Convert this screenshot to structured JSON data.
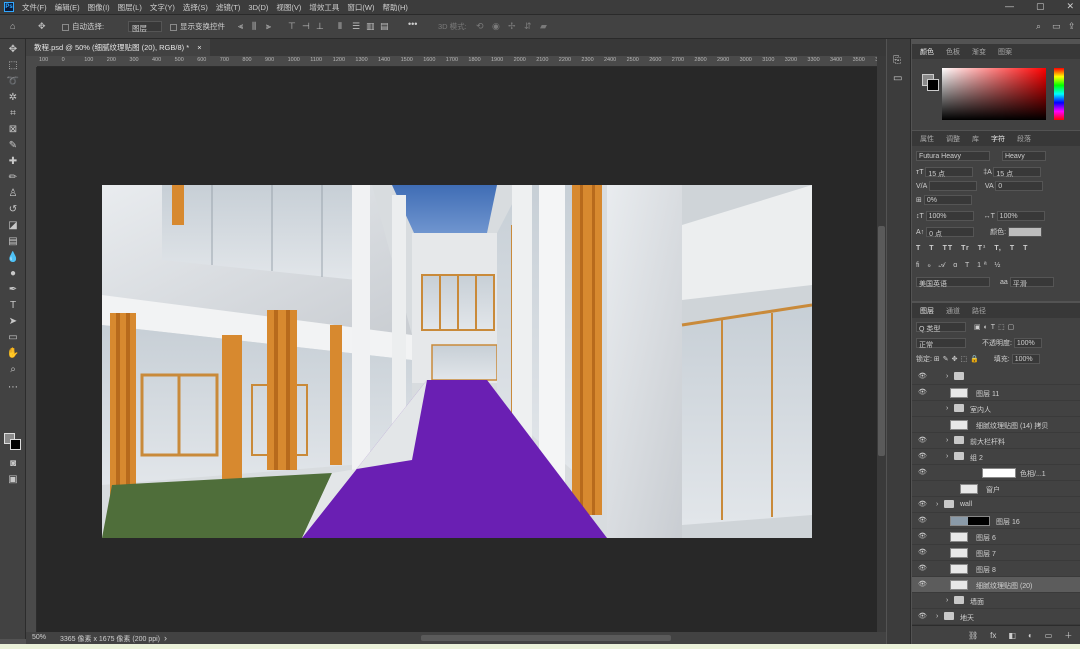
{
  "app": {
    "logo": "Ps"
  },
  "menu": [
    "文件(F)",
    "编辑(E)",
    "图像(I)",
    "图层(L)",
    "文字(Y)",
    "选择(S)",
    "滤镜(T)",
    "3D(D)",
    "视图(V)",
    "增效工具",
    "窗口(W)",
    "帮助(H)"
  ],
  "window_controls": {
    "minimize": "—",
    "maximize": "▢",
    "close": "✕"
  },
  "options": {
    "auto_select_label": "自动选择:",
    "auto_select_value": "图层",
    "transform_label": "显示变换控件",
    "mode_3d_label": "3D 模式:",
    "more": "•••"
  },
  "document_tab": {
    "title": "教程.psd @ 50% (细腻纹理贴图 (20), RGB/8) *",
    "close": "×"
  },
  "ruler_ticks": [
    "100",
    "0",
    "100",
    "200",
    "300",
    "400",
    "500",
    "600",
    "700",
    "800",
    "900",
    "1000",
    "1100",
    "1200",
    "1300",
    "1400",
    "1500",
    "1600",
    "1700",
    "1800",
    "1900",
    "2000",
    "2100",
    "2200",
    "2300",
    "2400",
    "2500",
    "2600",
    "2700",
    "2800",
    "2900",
    "3000",
    "3100",
    "3200",
    "3300",
    "3400",
    "3500",
    "3600"
  ],
  "status": {
    "zoom": "50%",
    "doc_info": "3365 像素 x 1675 像素 (200 ppi)",
    "arrow": "›"
  },
  "color_panel": {
    "tabs": [
      "颜色",
      "色板",
      "渐变",
      "图案"
    ],
    "active": 0
  },
  "char_panel": {
    "tabs": [
      "属性",
      "调整",
      "库",
      "字符",
      "段落"
    ],
    "active": 3,
    "font_family": "Futura Heavy",
    "font_style": "Heavy",
    "size": "15 点",
    "leading": "15 点",
    "kerning": "",
    "tracking": "0",
    "scale_pct": "0%",
    "vscale": "100%",
    "hscale": "100%",
    "baseline": "0 点",
    "color_label": "颜色:",
    "type_styles": [
      "T",
      "T",
      "TT",
      "Tr",
      "T¹",
      "T,",
      "T",
      "T"
    ],
    "language": "美国英语",
    "aa_label": "aa",
    "aa_mode": "平滑"
  },
  "layers_panel": {
    "tabs": [
      "图层",
      "通道",
      "路径"
    ],
    "active": 0,
    "filter_kind": "Q 类型",
    "blend_mode": "正常",
    "opacity_label": "不透明度:",
    "opacity": "100%",
    "lock_label": "锁定:",
    "fill_label": "填充:",
    "fill": "100%",
    "layers": [
      {
        "name": "",
        "type": "group",
        "indent": 1,
        "visible": true
      },
      {
        "name": "图层 11",
        "type": "pixel",
        "indent": 1,
        "visible": true
      },
      {
        "name": "室内人",
        "type": "group",
        "indent": 1,
        "visible": false
      },
      {
        "name": "细腻纹理贴图 (14) 拷贝",
        "type": "pixel",
        "indent": 1,
        "visible": false
      },
      {
        "name": "前大栏杆料",
        "type": "group",
        "indent": 1,
        "visible": true
      },
      {
        "name": "组 2",
        "type": "group",
        "indent": 1,
        "visible": true
      },
      {
        "name": "色相/...1",
        "type": "adjust",
        "indent": 2,
        "visible": true
      },
      {
        "name": "窗户",
        "type": "pixel",
        "indent": 2,
        "visible": false
      },
      {
        "name": "wall",
        "type": "group",
        "indent": 0,
        "visible": true
      },
      {
        "name": "图层 16",
        "type": "mask",
        "indent": 1,
        "visible": true
      },
      {
        "name": "图层 6",
        "type": "pixel",
        "indent": 1,
        "visible": true
      },
      {
        "name": "图层 7",
        "type": "pixel",
        "indent": 1,
        "visible": true
      },
      {
        "name": "图层 8",
        "type": "pixel",
        "indent": 1,
        "visible": true
      },
      {
        "name": "细腻纹理贴图 (20)",
        "type": "pixel",
        "indent": 1,
        "visible": true,
        "selected": true
      },
      {
        "name": "墙面",
        "type": "group",
        "indent": 1,
        "visible": false
      },
      {
        "name": "地天",
        "type": "group",
        "indent": 0,
        "visible": true
      }
    ],
    "footer": [
      "⛓",
      "fx",
      "◧",
      "◐",
      "▭",
      "＋",
      "🗑"
    ]
  }
}
